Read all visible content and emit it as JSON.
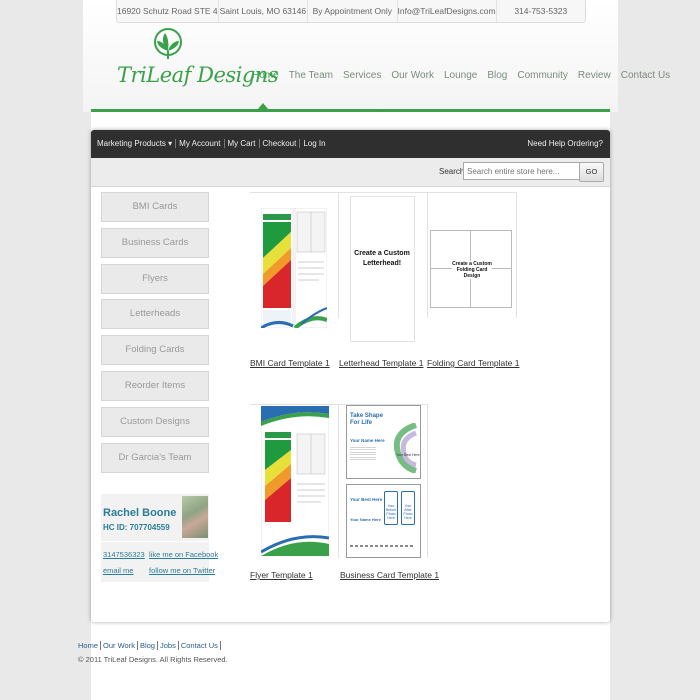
{
  "topbar": {
    "address": "16920 Schutz Road STE 4",
    "city": "Saint Louis, MO 63146",
    "hours": "By Appointment Only",
    "email": "Info@TriLeafDesigns.com",
    "phone": "314-753-5323"
  },
  "logo": {
    "text": "TriLeaf Designs",
    "color": "#3aa14a"
  },
  "nav": {
    "items": [
      "Home",
      "The Team",
      "Services",
      "Our Work",
      "Lounge",
      "Blog",
      "Community",
      "Review",
      "Contact Us"
    ],
    "active": "Home"
  },
  "storebar": {
    "links": [
      "Marketing Products ▾",
      "My Account",
      "My Cart",
      "Checkout",
      "Log In"
    ],
    "help": "Need Help Ordering?"
  },
  "search": {
    "label": "Search",
    "placeholder": "Search entire store here...",
    "button": "GO"
  },
  "sidebar": {
    "items": [
      "BMI Cards",
      "Business Cards",
      "Flyers",
      "Letterheads",
      "Folding Cards",
      "Reorder Items",
      "Custom Designs",
      "Dr Garcia's Team"
    ]
  },
  "profile": {
    "name": "Rachel Boone",
    "hc_id": "HC ID: 707704559",
    "phone": "3147536323",
    "email_link": "email me",
    "facebook_link": "like me on Facebook",
    "twitter_link": "follow me on Twitter"
  },
  "products": [
    {
      "caption": "BMI Card Template 1",
      "thumb_text": ""
    },
    {
      "caption": "Letterhead Template 1",
      "thumb_text": "Create a Custom Letterhead!"
    },
    {
      "caption": "Folding Card Template 1",
      "thumb_text": "Create a Custom Folding Card Design"
    },
    {
      "caption": "Flyer Template 1",
      "thumb_text": ""
    },
    {
      "caption": "Business Card Template 1",
      "thumb_text": "Take Shape For Life"
    }
  ],
  "bizcard": {
    "name_line": "Your Name Here",
    "best_line": "Your Best Here",
    "before": "Your Before Photo Here",
    "after": "Your After Photo Here",
    "side": "Your Best Here"
  },
  "footer": {
    "links": [
      "Home",
      "Our Work",
      "Blog",
      "Jobs",
      "Contact Us"
    ],
    "copyright": "© 2011 TriLeaf Designs. All Rights Reserved."
  },
  "colors": {
    "accent_green": "#3aa14a",
    "link_blue": "#2a7d9a",
    "dark_bar": "#2f2f2f"
  }
}
